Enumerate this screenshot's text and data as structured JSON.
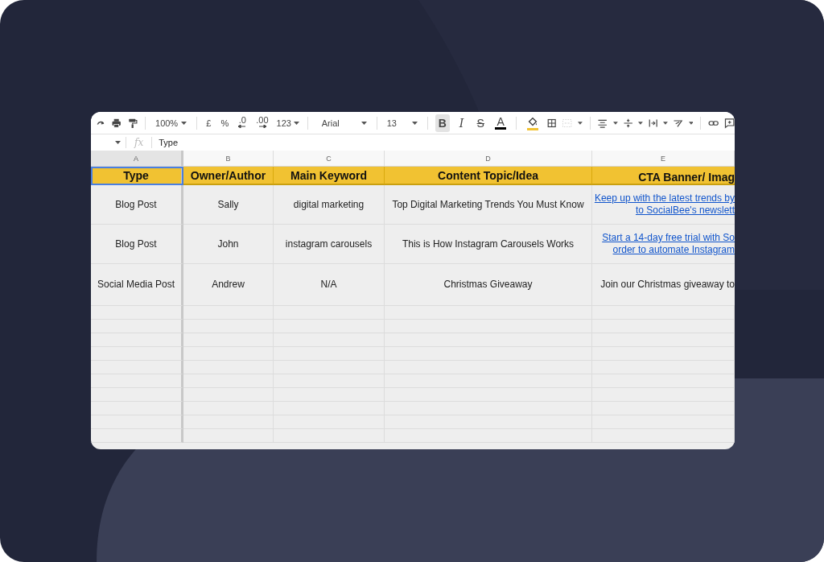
{
  "toolbar": [
    {
      "kind": "redo",
      "disabled": false
    },
    {
      "kind": "print",
      "disabled": false
    },
    {
      "kind": "paint",
      "disabled": false
    },
    {
      "kind": "separator"
    },
    {
      "kind": "select",
      "label": "100%",
      "disabled": false
    },
    {
      "kind": "separator"
    },
    {
      "kind": "glyph",
      "label": "£",
      "disabled": false
    },
    {
      "kind": "glyph",
      "label": "%",
      "disabled": false
    },
    {
      "kind": "dec-less",
      "label": ".0",
      "disabled": false
    },
    {
      "kind": "dec-more",
      "label": ".00",
      "disabled": false
    },
    {
      "kind": "small-select",
      "label": "123",
      "disabled": false
    },
    {
      "kind": "separator"
    },
    {
      "kind": "wide-select",
      "label": "Arial",
      "disabled": false
    },
    {
      "kind": "separator"
    },
    {
      "kind": "select",
      "label": "13",
      "disabled": false
    },
    {
      "kind": "separator"
    },
    {
      "kind": "bold",
      "label": "B",
      "selected": true,
      "disabled": false
    },
    {
      "kind": "italic",
      "label": "I",
      "selected": false,
      "disabled": false
    },
    {
      "kind": "strike",
      "label": "S",
      "selected": false,
      "disabled": false
    },
    {
      "kind": "text-color",
      "label": "A",
      "color": "#000000",
      "disabled": false
    },
    {
      "kind": "separator"
    },
    {
      "kind": "fill-color",
      "color": "#f1c232",
      "disabled": false
    },
    {
      "kind": "borders",
      "disabled": false
    },
    {
      "kind": "merge",
      "disabled": true
    },
    {
      "kind": "separator"
    },
    {
      "kind": "align",
      "disabled": false
    },
    {
      "kind": "valign",
      "disabled": false
    },
    {
      "kind": "wrap",
      "disabled": false
    },
    {
      "kind": "rotate",
      "disabled": false
    },
    {
      "kind": "separator"
    },
    {
      "kind": "link",
      "disabled": false
    },
    {
      "kind": "comment",
      "disabled": false
    }
  ],
  "formula_bar": {
    "function_label": "fx",
    "value": "Type"
  },
  "columns": [
    {
      "letter": "A",
      "selected": true
    },
    {
      "letter": "B",
      "selected": false
    },
    {
      "letter": "C",
      "selected": false
    },
    {
      "letter": "D",
      "selected": false
    },
    {
      "letter": "E",
      "selected": false
    }
  ],
  "header_row": [
    {
      "text": "Type",
      "selected": true
    },
    {
      "text": "Owner/Author",
      "selected": false
    },
    {
      "text": "Main Keyword",
      "selected": false
    },
    {
      "text": "Content Topic/Idea",
      "selected": false
    },
    {
      "text": "CTA Banner/ Imag",
      "selected": false
    }
  ],
  "rows": [
    {
      "cells": [
        {
          "kind": "text",
          "lines": [
            "Blog Post"
          ]
        },
        {
          "kind": "text",
          "lines": [
            "Sally"
          ]
        },
        {
          "kind": "text",
          "lines": [
            "digital marketing"
          ]
        },
        {
          "kind": "text",
          "lines": [
            "Top Digital Marketing Trends You Must Know"
          ]
        },
        {
          "kind": "link",
          "lines": [
            "Keep up with the latest trends by",
            "to SocialBee's newslett"
          ]
        }
      ]
    },
    {
      "cells": [
        {
          "kind": "text",
          "lines": [
            "Blog Post"
          ]
        },
        {
          "kind": "text",
          "lines": [
            "John"
          ]
        },
        {
          "kind": "text",
          "lines": [
            "instagram carousels"
          ]
        },
        {
          "kind": "text",
          "lines": [
            "This is How Instagram Carousels Works"
          ]
        },
        {
          "kind": "link",
          "lines": [
            "Start a 14-day free trial with So",
            "order to automate Instagram"
          ]
        }
      ]
    },
    {
      "cells": [
        {
          "kind": "text",
          "lines": [
            "Social Media Post"
          ]
        },
        {
          "kind": "text",
          "lines": [
            "Andrew"
          ]
        },
        {
          "kind": "text",
          "lines": [
            "N/A"
          ]
        },
        {
          "kind": "text",
          "lines": [
            "Christmas Giveaway"
          ]
        },
        {
          "kind": "text",
          "lines": [
            "Join our Christmas giveaway to"
          ]
        }
      ]
    }
  ]
}
